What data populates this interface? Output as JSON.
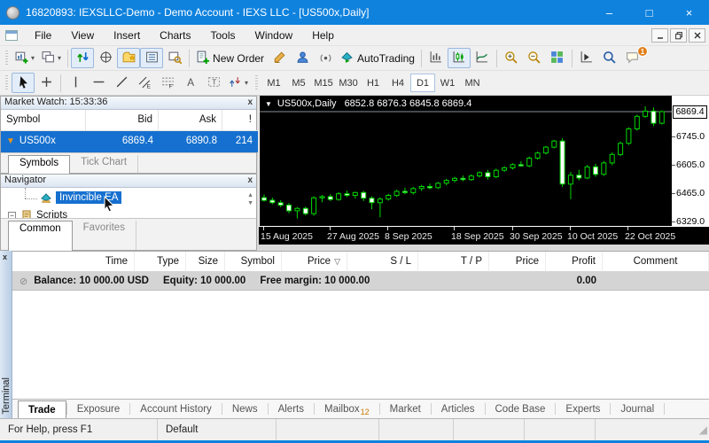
{
  "window": {
    "title": "16820893: IEXSLLC-Demo - Demo Account - IEXS LLC - [US500x,Daily]",
    "minimize": "–",
    "maximize": "□",
    "close": "×"
  },
  "menu": {
    "items": [
      "File",
      "View",
      "Insert",
      "Charts",
      "Tools",
      "Window",
      "Help"
    ]
  },
  "toolbar_main": [
    {
      "name": "new-chart-button",
      "icon": "new-chart-icon",
      "dropdown": true,
      "group": 1
    },
    {
      "name": "profiles-button",
      "icon": "chart-profiles-icon",
      "dropdown": true,
      "group": 1
    },
    {
      "name": "market-watch-toggle",
      "icon": "market-watch-icon",
      "pressed": true,
      "group": 2
    },
    {
      "name": "data-window-toggle",
      "icon": "data-window-icon",
      "group": 2
    },
    {
      "name": "navigator-toggle",
      "icon": "navigator-icon",
      "pressed": true,
      "group": 2
    },
    {
      "name": "terminal-toggle",
      "icon": "terminal-icon",
      "pressed": true,
      "group": 2
    },
    {
      "name": "strategy-tester-toggle",
      "icon": "strategy-tester-icon",
      "group": 2
    },
    {
      "name": "new-order-button",
      "icon": "new-order-icon",
      "label": "New Order",
      "group": 3
    },
    {
      "name": "metaeditor-button",
      "icon": "metaeditor-icon",
      "group": 3
    },
    {
      "name": "community-button",
      "icon": "community-icon",
      "group": 3
    },
    {
      "name": "signals-button",
      "icon": "signals-icon",
      "group": 3
    },
    {
      "name": "autotrading-button",
      "icon": "autotrading-icon",
      "label": "AutoTrading",
      "group": 3
    },
    {
      "name": "bar-chart-button",
      "icon": "bar-chart-icon",
      "group": 4
    },
    {
      "name": "candlestick-button",
      "icon": "candlestick-icon",
      "pressed": true,
      "group": 4
    },
    {
      "name": "line-chart-button",
      "icon": "line-chart-icon",
      "group": 4
    },
    {
      "name": "zoom-in-button",
      "icon": "zoom-in-icon",
      "group": 5
    },
    {
      "name": "zoom-out-button",
      "icon": "zoom-out-icon",
      "group": 5
    },
    {
      "name": "tile-windows-button",
      "icon": "tile-windows-icon",
      "group": 5
    },
    {
      "name": "chart-shift-button",
      "icon": "chart-shift-icon",
      "group": 6
    },
    {
      "name": "search-button",
      "icon": "search-icon",
      "group": 6
    },
    {
      "name": "chat-button",
      "icon": "chat-icon",
      "badge": "1",
      "group": 6
    }
  ],
  "toolbar_draw": [
    {
      "name": "cursor-button",
      "icon": "cursor-icon",
      "pressed": true
    },
    {
      "name": "crosshair-button",
      "icon": "crosshair-icon"
    },
    {
      "name": "vertical-line-button",
      "icon": "vertical-line-icon"
    },
    {
      "name": "horizontal-line-button",
      "icon": "horizontal-line-icon"
    },
    {
      "name": "trendline-button",
      "icon": "trendline-icon"
    },
    {
      "name": "channel-button",
      "icon": "equidistant-channel-icon"
    },
    {
      "name": "fibonacci-button",
      "icon": "fibonacci-icon"
    },
    {
      "name": "text-button",
      "icon": "text-icon"
    },
    {
      "name": "label-button",
      "icon": "text-label-icon"
    },
    {
      "name": "arrows-button",
      "icon": "arrows-icon",
      "dropdown": true
    }
  ],
  "timeframes": {
    "items": [
      "M1",
      "M5",
      "M15",
      "M30",
      "H1",
      "H4",
      "D1",
      "W1",
      "MN"
    ],
    "active": "D1"
  },
  "market_watch": {
    "title": "Market Watch: 15:33:36",
    "columns": [
      "Symbol",
      "Bid",
      "Ask",
      "!"
    ],
    "rows": [
      {
        "symbol": "US500x",
        "bid": "6869.4",
        "ask": "6890.8",
        "alert": "214"
      }
    ],
    "tabs": [
      "Symbols",
      "Tick Chart"
    ],
    "active_tab": "Symbols"
  },
  "navigator": {
    "title": "Navigator",
    "items": [
      {
        "label": "Invincible EA",
        "icon": "expert-advisor-icon",
        "selected": true
      },
      {
        "label": "Scripts",
        "icon": "scripts-icon",
        "expander": "-"
      }
    ],
    "tabs": [
      "Common",
      "Favorites"
    ],
    "active_tab": "Common"
  },
  "terminal": {
    "columns": [
      "Time",
      "Type",
      "Size",
      "Symbol",
      "Price",
      "S / L",
      "T / P",
      "Price",
      "Profit",
      "Comment"
    ],
    "sort_glyph": "▽",
    "sort_column_index": 4,
    "balance_row": {
      "balance": "Balance: 10 000.00 USD",
      "equity": "Equity: 10 000.00",
      "free_margin": "Free margin: 10 000.00",
      "profit": "0.00"
    },
    "tabs": [
      "Trade",
      "Exposure",
      "Account History",
      "News",
      "Alerts",
      "Mailbox",
      "Market",
      "Articles",
      "Code Base",
      "Experts",
      "Journal"
    ],
    "active_tab": "Trade",
    "mailbox_badge": "12",
    "side_label": "Terminal"
  },
  "status_bar": {
    "help": "For Help, press F1",
    "profile": "Default"
  },
  "chart_data": {
    "type": "candlestick",
    "symbol": "US500x",
    "period": "Daily",
    "title_symbol": "US500x,Daily",
    "title_ohlc": "6852.8 6876.3 6845.8 6869.4",
    "current_price": 6869.4,
    "current_price_label": "6869.4",
    "price_min": 6301,
    "price_max": 6948,
    "y_ticks": [
      {
        "label": "6745.0",
        "value": 6745
      },
      {
        "label": "6605.0",
        "value": 6605
      },
      {
        "label": "6465.0",
        "value": 6465
      },
      {
        "label": "6329.0",
        "value": 6329
      }
    ],
    "x_ticks": [
      {
        "label": "15 Aug 2025",
        "index": 0
      },
      {
        "label": "27 Aug 2025",
        "index": 8
      },
      {
        "label": "8 Sep 2025",
        "index": 15
      },
      {
        "label": "18 Sep 2025",
        "index": 23
      },
      {
        "label": "30 Sep 2025",
        "index": 30
      },
      {
        "label": "10 Oct 2025",
        "index": 37
      },
      {
        "label": "22 Oct 2025",
        "index": 44
      }
    ],
    "colors": {
      "outline": "#00d800",
      "bull_fill": "#000000",
      "bear_fill": "#ffffff",
      "background": "#000000",
      "axis_text": "#e8e8e8",
      "price_line": "#8a9097"
    },
    "candles": [
      [
        6445,
        6460,
        6425,
        6432
      ],
      [
        6432,
        6445,
        6412,
        6420
      ],
      [
        6420,
        6432,
        6398,
        6408
      ],
      [
        6408,
        6418,
        6368,
        6380
      ],
      [
        6380,
        6398,
        6342,
        6392
      ],
      [
        6392,
        6400,
        6358,
        6366
      ],
      [
        6366,
        6452,
        6355,
        6444
      ],
      [
        6444,
        6458,
        6422,
        6450
      ],
      [
        6450,
        6462,
        6428,
        6436
      ],
      [
        6436,
        6472,
        6430,
        6464
      ],
      [
        6464,
        6480,
        6448,
        6456
      ],
      [
        6456,
        6474,
        6440,
        6470
      ],
      [
        6470,
        6478,
        6428,
        6442
      ],
      [
        6442,
        6452,
        6388,
        6420
      ],
      [
        6420,
        6446,
        6348,
        6438
      ],
      [
        6438,
        6464,
        6430,
        6456
      ],
      [
        6456,
        6484,
        6448,
        6476
      ],
      [
        6476,
        6494,
        6462,
        6470
      ],
      [
        6470,
        6498,
        6460,
        6490
      ],
      [
        6490,
        6508,
        6478,
        6500
      ],
      [
        6500,
        6514,
        6486,
        6494
      ],
      [
        6494,
        6522,
        6488,
        6516
      ],
      [
        6516,
        6538,
        6506,
        6530
      ],
      [
        6530,
        6548,
        6520,
        6540
      ],
      [
        6540,
        6554,
        6526,
        6534
      ],
      [
        6534,
        6560,
        6528,
        6552
      ],
      [
        6552,
        6575,
        6544,
        6568
      ],
      [
        6568,
        6582,
        6534,
        6548
      ],
      [
        6548,
        6588,
        6542,
        6580
      ],
      [
        6580,
        6600,
        6572,
        6592
      ],
      [
        6592,
        6615,
        6584,
        6608
      ],
      [
        6608,
        6625,
        6598,
        6602
      ],
      [
        6602,
        6648,
        6595,
        6640
      ],
      [
        6640,
        6672,
        6632,
        6665
      ],
      [
        6665,
        6700,
        6658,
        6694
      ],
      [
        6694,
        6730,
        6688,
        6724
      ],
      [
        6724,
        6738,
        6498,
        6512
      ],
      [
        6512,
        6572,
        6438,
        6556
      ],
      [
        6556,
        6582,
        6530,
        6542
      ],
      [
        6542,
        6606,
        6536,
        6597
      ],
      [
        6597,
        6612,
        6548,
        6560
      ],
      [
        6560,
        6626,
        6552,
        6616
      ],
      [
        6616,
        6668,
        6605,
        6658
      ],
      [
        6658,
        6722,
        6650,
        6713
      ],
      [
        6713,
        6792,
        6705,
        6784
      ],
      [
        6784,
        6854,
        6776,
        6846
      ],
      [
        6846,
        6896,
        6838,
        6872
      ],
      [
        6872,
        6890,
        6798,
        6812
      ],
      [
        6812,
        6876,
        6806,
        6869.4
      ]
    ]
  }
}
